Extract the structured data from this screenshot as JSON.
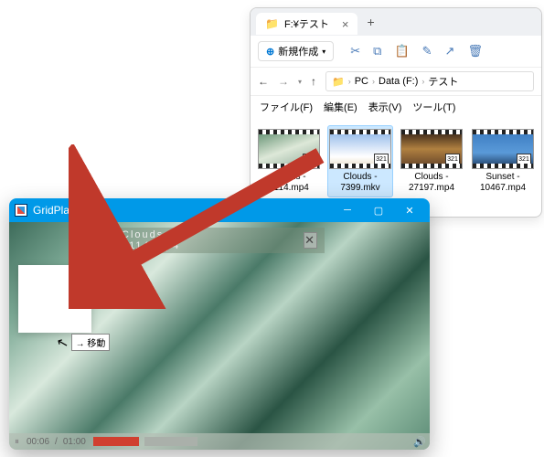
{
  "explorer": {
    "tab_title": "F:¥テスト",
    "new_button": "新規作成",
    "breadcrumb": {
      "pc": "PC",
      "drive": "Data (F:)",
      "folder": "テスト"
    },
    "menu": {
      "file": "ファイル(F)",
      "edit": "編集(E)",
      "view": "表示(V)",
      "tools": "ツール(T)"
    },
    "files": [
      {
        "name": "Clouds - 2114.mp4",
        "selected": false
      },
      {
        "name": "Clouds - 7399.mkv",
        "selected": true
      },
      {
        "name": "Clouds - 27197.mp4",
        "selected": false
      },
      {
        "name": "Sunset - 10467.mp4",
        "selected": false
      }
    ],
    "badge": "321"
  },
  "player": {
    "title": "GridPlayer",
    "overlay_filename": "Clouds - 2114.mp4",
    "time_current": "00:06",
    "time_total": "01:00",
    "drag_tooltip": "→ 移動"
  }
}
